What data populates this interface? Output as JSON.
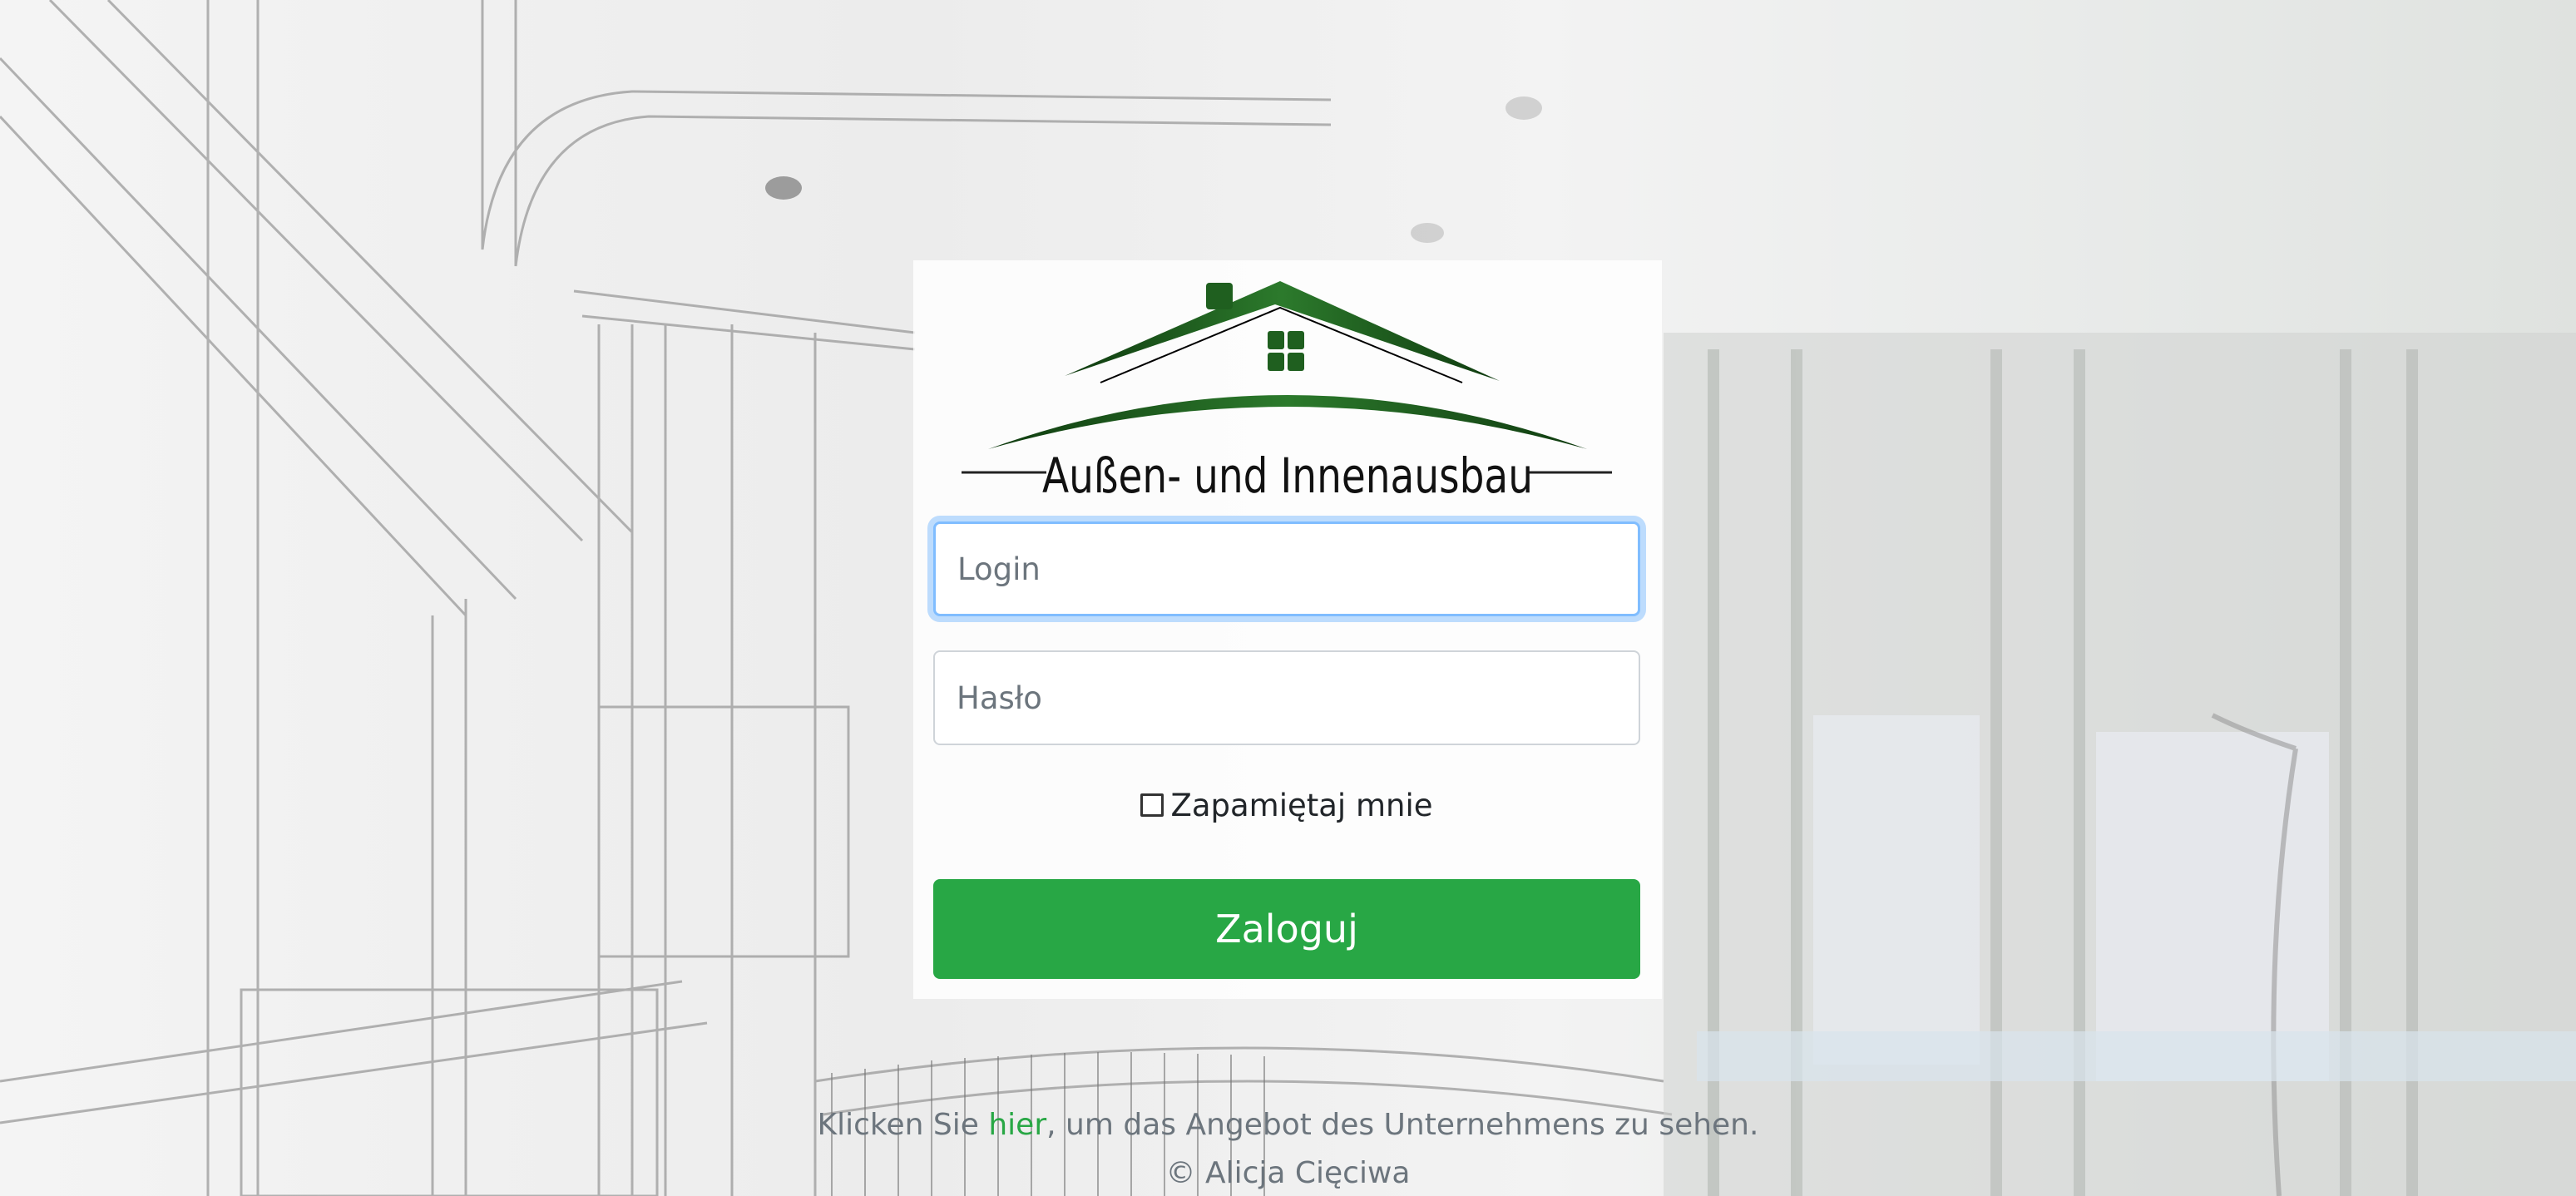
{
  "brand": {
    "logo_text": "Außen- und Innenausbau",
    "colors": {
      "primary_green": "#28a745",
      "logo_green_dark": "#1f5f1f"
    }
  },
  "form": {
    "login": {
      "placeholder": "Login",
      "value": ""
    },
    "password": {
      "placeholder": "Hasło",
      "value": ""
    },
    "remember_label": "Zapamiętaj mnie",
    "remember_checked": false,
    "submit_label": "Zaloguj"
  },
  "footer": {
    "info_before": "Klicken Sie ",
    "info_link": "hier",
    "info_after": ", um das Angebot des Unternehmens zu sehen.",
    "copyright": "© Alicja Cięciwa"
  }
}
